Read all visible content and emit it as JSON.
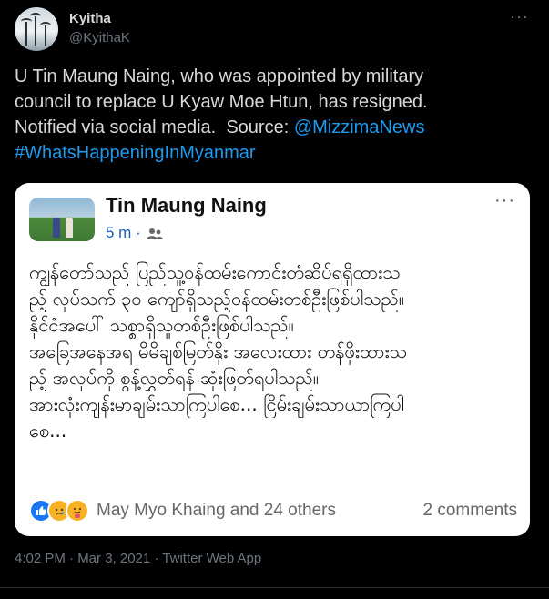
{
  "tweet": {
    "author_name": "Kyitha",
    "author_handle": "@KyithaK",
    "more_label": "···",
    "text_lines": [
      "U Tin Maung Naing, who was appointed by military",
      "council to replace U Kyaw Moe Htun, has resigned.",
      "Notified via social media.  Source: "
    ],
    "source_link": "@MizzimaNews",
    "hashtag": "#WhatsHappeningInMyanmar",
    "timestamp": "4:02 PM · Mar 3, 2021 · Twitter Web App",
    "colors": {
      "background": "#000000",
      "link": "#1d9bf0",
      "muted": "#6e767d"
    }
  },
  "fb_post": {
    "author": "Tin Maung Naing",
    "time": "5 m",
    "audience_icon": "friends-icon",
    "more_label": "···",
    "body_lines": [
      "ကျွန်တော်သည် ပြည်သူ့ဝန်ထမ်းကောင်းတံဆိပ်ရရှိထားသ",
      "ည့် လုပ်သက် ၃၀ ကျော်ရှိသည့်ဝန်ထမ်းတစ်ဦးဖြစ်ပါသည်။",
      "နိုင်ငံအပေါ် သစ္စာရှိသူတစ်ဦးဖြစ်ပါသည်။",
      "အခြေအနေအရ မိမိချစ်မြတ်နိုး အလေးထား တန်ဖိုးထားသ",
      "ည့် အလုပ်ကို စွန့်လွှတ်ရန် ဆုံးဖြတ်ရပါသည်။",
      "အားလုံးကျန်းမာချမ်းသာကြပါစေ... ငြိမ်းချမ်းသာယာကြပါ",
      "စေ..."
    ],
    "reactions": [
      "like-icon",
      "sad-icon",
      "care-icon"
    ],
    "reaction_text": "May Myo Khaing and 24 others",
    "comments_text": "2 comments"
  }
}
